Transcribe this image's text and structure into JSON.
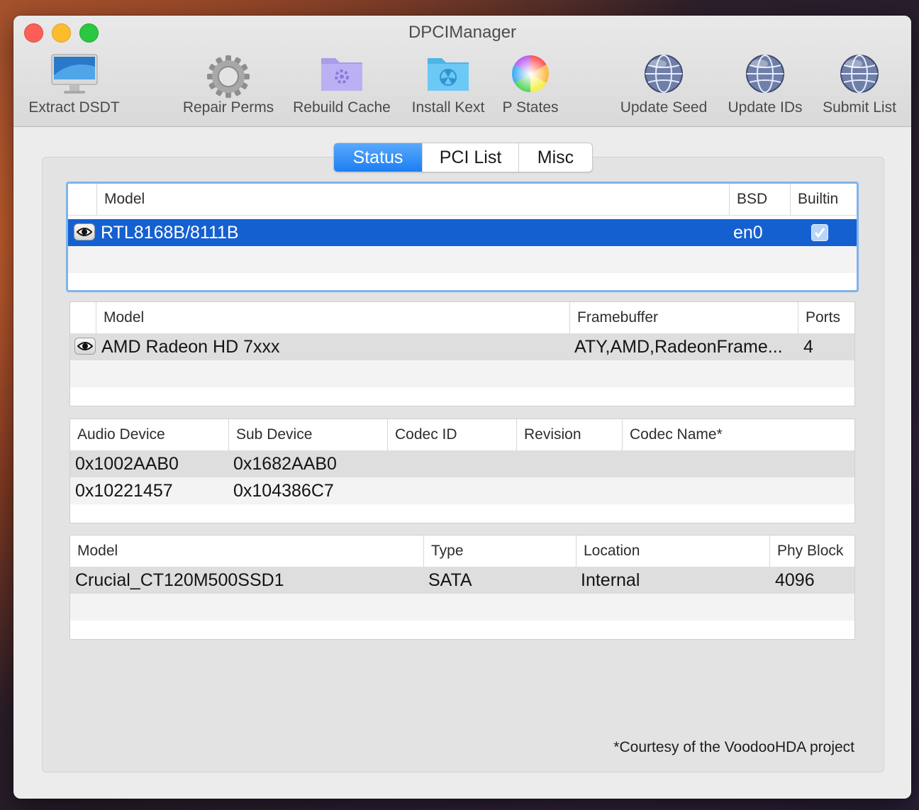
{
  "window": {
    "title": "DPCIManager"
  },
  "toolbar": {
    "extract_dsdt": "Extract DSDT",
    "repair_perms": "Repair Perms",
    "rebuild_cache": "Rebuild Cache",
    "install_kext": "Install Kext",
    "p_states": "P States",
    "update_seed": "Update Seed",
    "update_ids": "Update IDs",
    "submit_list": "Submit List"
  },
  "tabs": {
    "status": "Status",
    "pci_list": "PCI List",
    "misc": "Misc",
    "selected": "Status"
  },
  "network": {
    "headers": {
      "model": "Model",
      "bsd": "BSD",
      "builtin": "Builtin"
    },
    "rows": [
      {
        "model": "RTL8168B/8111B",
        "bsd": "en0",
        "builtin": true
      }
    ]
  },
  "graphics": {
    "headers": {
      "model": "Model",
      "framebuffer": "Framebuffer",
      "ports": "Ports"
    },
    "rows": [
      {
        "model": "AMD Radeon HD 7xxx",
        "framebuffer": "ATY,AMD,RadeonFrame...",
        "ports": "4"
      }
    ]
  },
  "audio": {
    "headers": {
      "audio_device": "Audio Device",
      "sub_device": "Sub Device",
      "codec_id": "Codec ID",
      "revision": "Revision",
      "codec_name": "Codec Name*"
    },
    "rows": [
      {
        "audio_device": "0x1002AAB0",
        "sub_device": "0x1682AAB0"
      },
      {
        "audio_device": "0x10221457",
        "sub_device": "0x104386C7"
      }
    ]
  },
  "storage": {
    "headers": {
      "model": "Model",
      "type": "Type",
      "location": "Location",
      "phy_block": "Phy Block"
    },
    "rows": [
      {
        "model": "Crucial_CT120M500SSD1",
        "type": "SATA",
        "location": "Internal",
        "phy_block": "4096"
      }
    ]
  },
  "footnote": "*Courtesy of the VoodooHDA project",
  "colors": {
    "selection": "#1560d0",
    "tab_active": "#1c7ef3",
    "focus_ring": "#7fb3ec"
  },
  "icons": [
    "imac-icon",
    "gear-icon",
    "rebuild-folder-icon",
    "install-kext-folder-icon",
    "color-wheel-icon",
    "globe-icon",
    "eye-icon",
    "checkbox-icon"
  ]
}
